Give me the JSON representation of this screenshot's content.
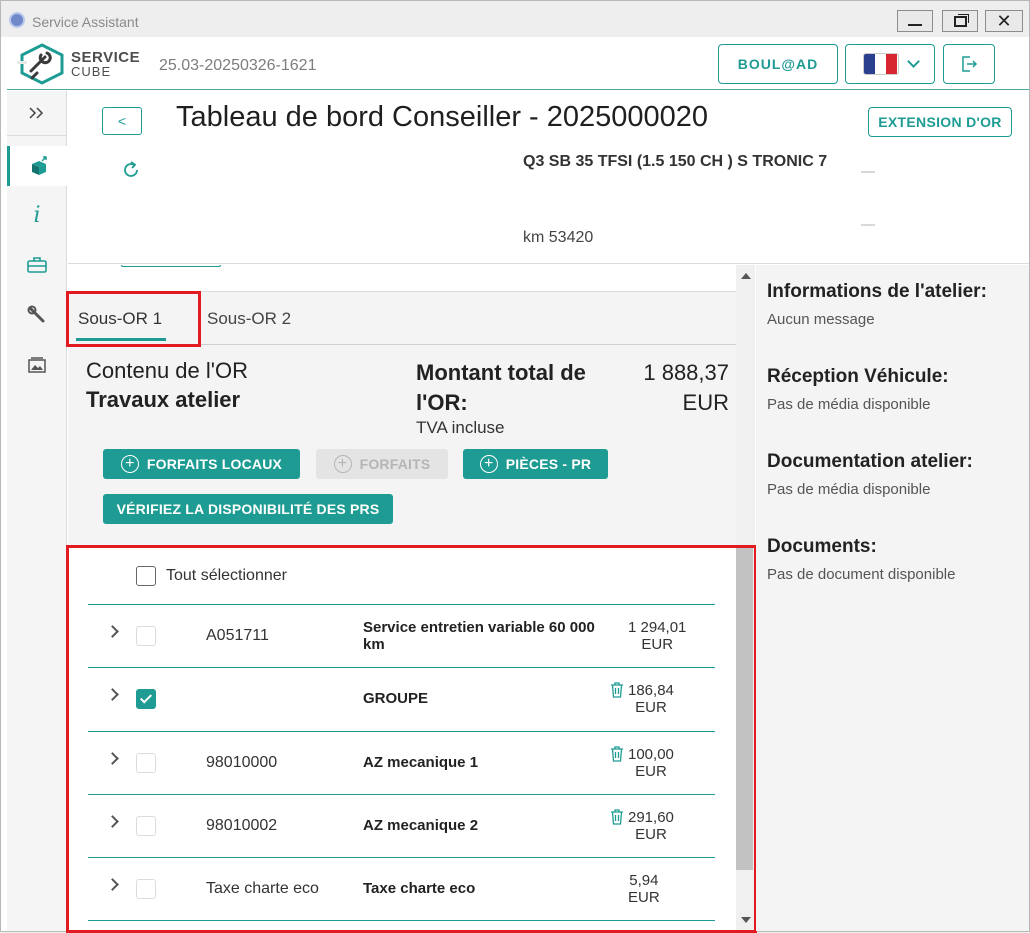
{
  "window": {
    "title": "Service Assistant"
  },
  "header": {
    "logo_line1": "SERVICE",
    "logo_line2": "CUBE",
    "version": "25.03-20250326-1621",
    "user_label": "BOUL@AD",
    "flag_colors": [
      "#2b3f8f",
      "#ffffff",
      "#d7262f"
    ],
    "accent": "#1e9c93"
  },
  "topinfo": {
    "back_label": "<",
    "title": "Tableau de bord Conseiller - 2025000020",
    "extension_label": "EXTENSION D'OR",
    "vehicle": "Q3 SB 35 TFSI (1.5 150 CH ) S TRONIC 7",
    "km": "km 53420"
  },
  "tabs": [
    {
      "label": "Sous-OR 1",
      "active": true
    },
    {
      "label": "Sous-OR 2",
      "active": false
    }
  ],
  "summary": {
    "contenu": "Contenu de l'OR",
    "travaux": "Travaux atelier",
    "montant_label": "Montant total de l'OR:",
    "tva": "TVA incluse",
    "total_value": "1 888,37",
    "total_currency": "EUR"
  },
  "actions": {
    "forfaits_locaux": "FORFAITS LOCAUX",
    "forfaits": "FORFAITS",
    "pieces": "PIÈCES - PR",
    "verifier": "VÉRIFIEZ LA DISPONIBILITÉ DES PRS"
  },
  "list": {
    "select_all": "Tout sélectionner",
    "rows": [
      {
        "code": "A051711",
        "label": "Service entretien variable 60 000 km",
        "amount": "1 294,01",
        "currency": "EUR",
        "checked": false,
        "trash": false
      },
      {
        "code": "",
        "label": "GROUPE",
        "amount": "186,84",
        "currency": "EUR",
        "checked": true,
        "trash": true
      },
      {
        "code": "98010000",
        "label": "AZ mecanique 1",
        "amount": "100,00",
        "currency": "EUR",
        "checked": false,
        "trash": true
      },
      {
        "code": "98010002",
        "label": "AZ mecanique 2",
        "amount": "291,60",
        "currency": "EUR",
        "checked": false,
        "trash": true
      },
      {
        "code": "Taxe charte eco",
        "label": "Taxe charte eco",
        "amount": "5,94",
        "currency": "EUR",
        "checked": false,
        "trash": false
      }
    ]
  },
  "right_panel": [
    {
      "title": "Informations de l'atelier:",
      "text": "Aucun message"
    },
    {
      "title": "Réception Véhicule:",
      "text": "Pas de média disponible"
    },
    {
      "title": "Documentation atelier:",
      "text": "Pas de média disponible"
    },
    {
      "title": "Documents:",
      "text": "Pas de document disponible"
    }
  ]
}
